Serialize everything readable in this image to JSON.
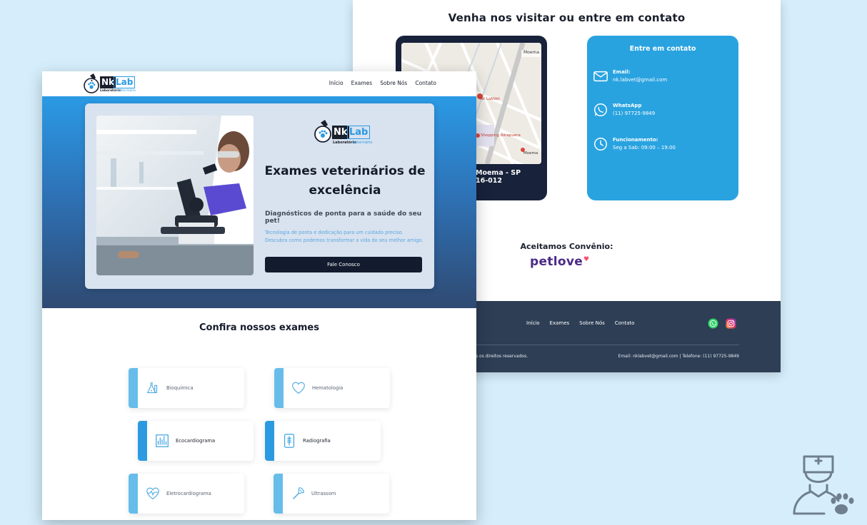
{
  "contact_page": {
    "visit_title": "Venha nos visitar ou entre em contato",
    "map": {
      "address_line1": "Moema - SP",
      "address_line2": "16-012",
      "labels": [
        "Moema",
        "Nk LabVet",
        "Shopping Ibirapuera",
        "Moema"
      ]
    },
    "contact": {
      "title": "Entre em contato",
      "email_label": "Email:",
      "email": "nk.labvet@gmail.com",
      "whatsapp_label": "WhatsApp",
      "whatsapp": "(11) 97725-9849",
      "hours_label": "Funcionamento:",
      "hours": "Seg a Sab: 09:00 – 19:00"
    },
    "accept_label": "Aceitamos Convênio:",
    "partner_logo": "petlove",
    "footer": {
      "nav": [
        "Início",
        "Exames",
        "Sobre Nós",
        "Contato"
      ],
      "copyright": "s os direitos reservados.",
      "contact_line": "Email: nklabvet@gmail.com | Telefone: (11) 97725-9849",
      "social_icons": [
        "whatsapp-icon",
        "instagram-icon"
      ]
    }
  },
  "home_page": {
    "brand": {
      "name_left": "Nk",
      "name_right": "Lab",
      "subtitle_left": "Laboratório",
      "subtitle_right": "Veterinário"
    },
    "nav": [
      "Início",
      "Exames",
      "Sobre Nós",
      "Contato"
    ],
    "hero": {
      "title": "Exames veterinários de excelência",
      "subtitle": "Diagnósticos de ponta para a saúde do seu pet!",
      "description": "Tecnologia de ponta e dedicação para um cuidado preciso. Descubra como podemos transformar a vida do seu melhor amigo.",
      "cta": "Fale Conosco"
    },
    "exams_title": "Confira nossos exames",
    "exams": [
      {
        "label": "Bioquímica",
        "icon": "flask-icon"
      },
      {
        "label": "Hematologia",
        "icon": "heart-icon"
      },
      {
        "label": "Ecocardiograma",
        "icon": "chart-icon"
      },
      {
        "label": "Radiografia",
        "icon": "xray-icon"
      },
      {
        "label": "Eletrocardiograma",
        "icon": "heartbeat-icon"
      },
      {
        "label": "Ultrassom",
        "icon": "ultrasound-icon"
      }
    ]
  },
  "colors": {
    "page_bg": "#d6eefb",
    "accent": "#29a3e0",
    "dark_navy": "#131b2e",
    "footer": "#2d3e55",
    "petlove": "#4b2a86"
  }
}
